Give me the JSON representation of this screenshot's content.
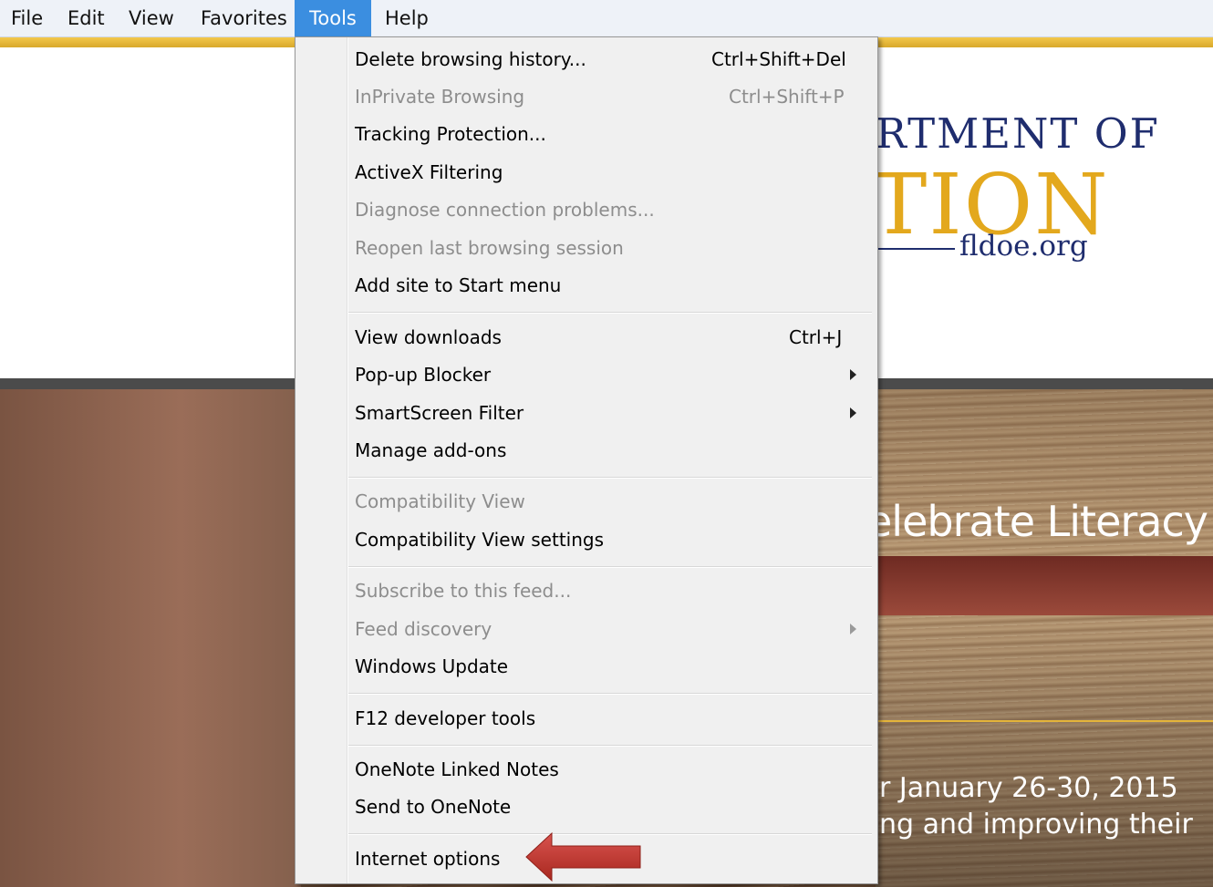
{
  "menubar": {
    "items": [
      "File",
      "Edit",
      "View",
      "Favorites",
      "Tools",
      "Help"
    ],
    "active_index": 4
  },
  "website": {
    "logo_line1": "RTMENT OF",
    "logo_line2": "TION",
    "logo_url": "fldoe.org",
    "banner_title": "elebrate Literacy",
    "banner_line1": "r January 26-30, 2015",
    "banner_line2": "ng and improving their"
  },
  "tools_menu": {
    "items": [
      {
        "label": "Delete browsing history...",
        "shortcut": "Ctrl+Shift+Del",
        "enabled": true
      },
      {
        "label": "InPrivate Browsing",
        "shortcut": "Ctrl+Shift+P",
        "enabled": false
      },
      {
        "label": "Tracking Protection...",
        "shortcut": "",
        "enabled": true
      },
      {
        "label": "ActiveX Filtering",
        "shortcut": "",
        "enabled": true
      },
      {
        "label": "Diagnose connection problems...",
        "shortcut": "",
        "enabled": false
      },
      {
        "label": "Reopen last browsing session",
        "shortcut": "",
        "enabled": false
      },
      {
        "label": "Add site to Start menu",
        "shortcut": "",
        "enabled": true
      },
      {
        "label": "View downloads",
        "shortcut": "Ctrl+J",
        "enabled": true
      },
      {
        "label": "Pop-up Blocker",
        "shortcut": "",
        "enabled": true,
        "submenu": true
      },
      {
        "label": "SmartScreen Filter",
        "shortcut": "",
        "enabled": true,
        "submenu": true
      },
      {
        "label": "Manage add-ons",
        "shortcut": "",
        "enabled": true
      },
      {
        "label": "Compatibility View",
        "shortcut": "",
        "enabled": false
      },
      {
        "label": "Compatibility View settings",
        "shortcut": "",
        "enabled": true
      },
      {
        "label": "Subscribe to this feed...",
        "shortcut": "",
        "enabled": false
      },
      {
        "label": "Feed discovery",
        "shortcut": "",
        "enabled": false,
        "submenu": true
      },
      {
        "label": "Windows Update",
        "shortcut": "",
        "enabled": true
      },
      {
        "label": "F12 developer tools",
        "shortcut": "",
        "enabled": true
      },
      {
        "label": "OneNote Linked Notes",
        "shortcut": "",
        "enabled": true
      },
      {
        "label": "Send to OneNote",
        "shortcut": "",
        "enabled": true
      },
      {
        "label": "Internet options",
        "shortcut": "",
        "enabled": true
      }
    ]
  },
  "colors": {
    "menubar_active": "#3b8ee0",
    "pointer_arrow": "#c0392b",
    "disabled_text": "#8d8d8d"
  }
}
